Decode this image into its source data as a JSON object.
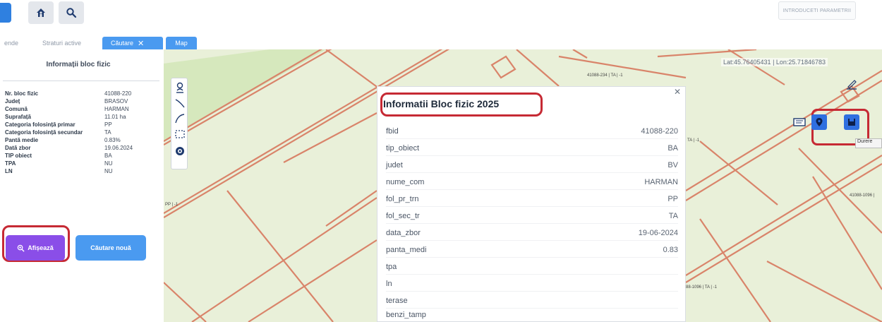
{
  "topbar": {
    "right_button_label": "INTRODUCETI PARAMETRII"
  },
  "tabs": [
    {
      "label": "ende"
    },
    {
      "label": "Straturi active"
    },
    {
      "label": "Căutare",
      "close": "✕"
    },
    {
      "label": "Map"
    }
  ],
  "side_panel": {
    "title": "Informații bloc fizic",
    "rows": [
      {
        "key": "Nr. bloc fizic",
        "value": "41088-220"
      },
      {
        "key": "Județ",
        "value": "BRASOV"
      },
      {
        "key": "Comună",
        "value": "HARMAN"
      },
      {
        "key": "Suprafață",
        "value": "11.01 ha"
      },
      {
        "key": "Categoria folosință primar",
        "value": "PP"
      },
      {
        "key": "Categoria folosință secundar",
        "value": "TA"
      },
      {
        "key": "Pantă medie",
        "value": "0.83%"
      },
      {
        "key": "Dată zbor",
        "value": "19.06.2024"
      },
      {
        "key": "TIP obiect",
        "value": "BA"
      },
      {
        "key": "TPA",
        "value": "NU"
      },
      {
        "key": "LN",
        "value": "NU"
      }
    ],
    "btn_afiseaza": "Afișează",
    "btn_cautare_noua": "Căutare nouă"
  },
  "map": {
    "coords": "Lat:45.76405431 | Lon:25.71846783",
    "labels": [
      {
        "text": "41088-234 | TA | -1"
      },
      {
        "text": "TA | -1"
      },
      {
        "text": "41088-1096 |"
      },
      {
        "text": "PP | -1"
      },
      {
        "text": "88-1096 | TA | -1"
      }
    ],
    "tooltip": "Durere"
  },
  "popup": {
    "close": "✕",
    "title": "Informatii Bloc fizic 2025",
    "rows": [
      {
        "key": "fbid",
        "value": "41088-220"
      },
      {
        "key": "tip_obiect",
        "value": "BA"
      },
      {
        "key": "judet",
        "value": "BV"
      },
      {
        "key": "nume_com",
        "value": "HARMAN"
      },
      {
        "key": "fol_pr_trn",
        "value": "PP"
      },
      {
        "key": "fol_sec_tr",
        "value": "TA"
      },
      {
        "key": "data_zbor",
        "value": "19-06-2024"
      },
      {
        "key": "panta_medi",
        "value": "0.83"
      },
      {
        "key": "tpa",
        "value": ""
      },
      {
        "key": "ln",
        "value": ""
      },
      {
        "key": "terase",
        "value": ""
      },
      {
        "key": "benzi_tamp",
        "value": ""
      }
    ]
  },
  "colors": {
    "accent_blue": "#4a9af0",
    "accent_purple": "#8a4ee8",
    "highlight_red": "#c62a34",
    "parcel_line": "#d9846a",
    "map_bg": "#e9f0d9"
  },
  "icons": [
    "home-icon",
    "search-icon",
    "zoom-icon",
    "person-marker-icon",
    "draw-line-icon",
    "draw-curve-icon",
    "draw-rectangle-icon",
    "layers-icon",
    "screen-icon",
    "location-pin-icon",
    "save-icon",
    "erase-icon"
  ]
}
